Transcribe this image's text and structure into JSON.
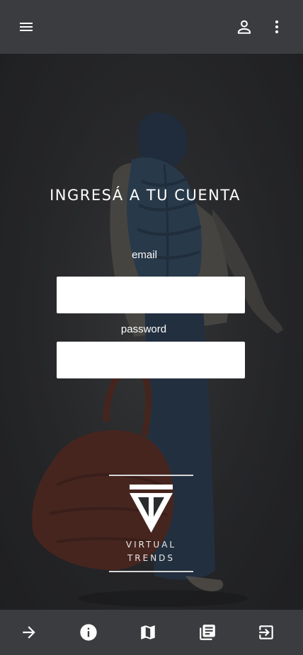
{
  "topbar": {
    "menu_icon": "menu-icon",
    "account_icon": "person-outline-icon",
    "more_icon": "more-vert-icon"
  },
  "login": {
    "title": "INGRESÁ A TU CUENTA",
    "email_label": "email",
    "email_value": "",
    "password_label": "password",
    "password_value": ""
  },
  "logo": {
    "line1": "VIRTUAL",
    "line2": "TRENDS"
  },
  "bottom_nav": {
    "items": [
      {
        "icon": "arrow-forward-icon"
      },
      {
        "icon": "info-icon"
      },
      {
        "icon": "map-icon"
      },
      {
        "icon": "library-books-icon"
      },
      {
        "icon": "exit-to-app-icon"
      }
    ]
  },
  "colors": {
    "bar_background": "#3b3c3f",
    "hero_background": "#2a2b2d",
    "text": "#ffffff",
    "input_background": "#ffffff"
  }
}
